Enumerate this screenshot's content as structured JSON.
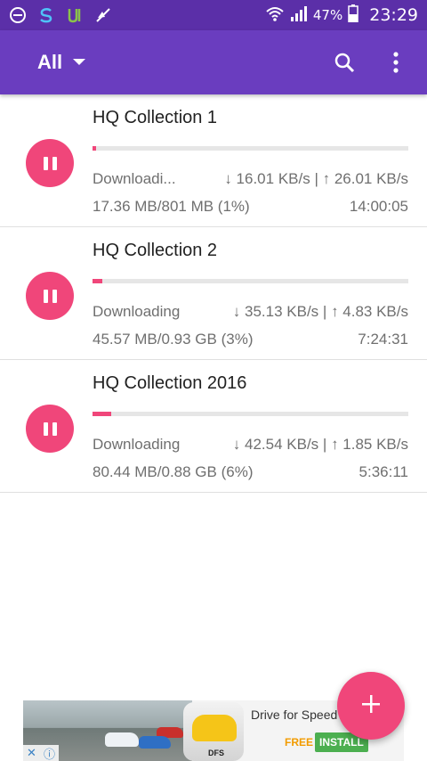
{
  "status_bar": {
    "battery": "47%",
    "time": "23:29",
    "icons": [
      "minus-circle-icon",
      "s-app-icon",
      "utorrent-icon",
      "muted-icon",
      "wifi-icon",
      "signal-icon",
      "battery-icon"
    ]
  },
  "app_bar": {
    "filter_label": "All",
    "icons": [
      "dropdown-arrow-icon",
      "search-icon",
      "more-vert-icon"
    ],
    "color": "#6a3dbf"
  },
  "downloads": [
    {
      "title": "HQ Collection 1",
      "status": "Downloadi...",
      "down_speed": "↓ 16.01 KB/s",
      "up_speed": "↑ 26.01 KB/s",
      "separator": "|",
      "size": "17.36 MB/801 MB (1%)",
      "eta": "14:00:05",
      "progress_percent": 1
    },
    {
      "title": "HQ Collection 2",
      "status": "Downloading",
      "down_speed": "↓ 35.13 KB/s",
      "up_speed": "↑ 4.83 KB/s",
      "separator": "|",
      "size": "45.57 MB/0.93 GB (3%)",
      "eta": "7:24:31",
      "progress_percent": 3
    },
    {
      "title": "HQ Collection 2016",
      "status": "Downloading",
      "down_speed": "↓ 42.54 KB/s",
      "up_speed": "↑ 1.85 KB/s",
      "separator": "|",
      "size": "80.44 MB/0.88 GB (6%)",
      "eta": "5:36:11",
      "progress_percent": 6
    }
  ],
  "ad": {
    "title": "Drive for Speed",
    "free_label": "FREE",
    "install_label": "INSTALL",
    "icon_tag": "DFS"
  },
  "fab": {
    "icon": "plus-icon"
  },
  "accent": "#f0467a"
}
